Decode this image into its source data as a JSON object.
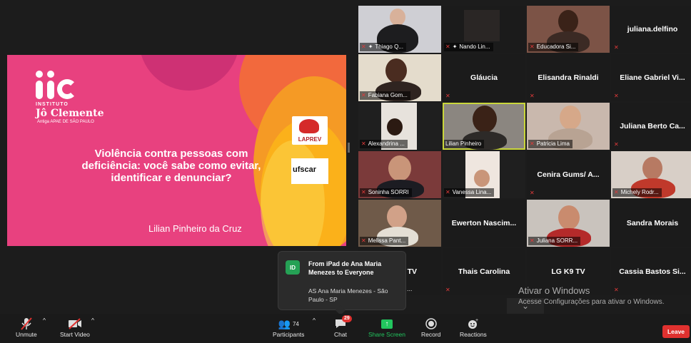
{
  "slide": {
    "logo_line1": "INSTITUTO",
    "logo_line2": "Jô Clemente",
    "logo_line3": "Antiga APAE DE SÃO PAULO",
    "title": "Violência contra pessoas com deficiência: você sabe como evitar, identificar e denunciar?",
    "author": "Lilian Pinheiro da Cruz",
    "partner1": "LAPREV",
    "partner2": "ufscar"
  },
  "tiles": [
    {
      "label": "Thiago Q...",
      "pinned": true
    },
    {
      "label": "Nando Lin...",
      "pinned": true
    },
    {
      "label": "Educadora Si..."
    },
    {
      "name": "juliana.delfino"
    },
    {
      "label": "Fabiana Gom..."
    },
    {
      "name": "Gláucia"
    },
    {
      "name": "Elisandra Rinaldi"
    },
    {
      "name": "Eliane Gabriel Vi..."
    },
    {
      "label": "Alexandrina ..."
    },
    {
      "label": "Lilian Pinheiro"
    },
    {
      "label": "Patricia Lima"
    },
    {
      "name": "Juliana Berto Ca..."
    },
    {
      "label": "Soninha SORRI"
    },
    {
      "label": "Vanessa Lina..."
    },
    {
      "name": "Cenira Gums/ A..."
    },
    {
      "label": "Michely Rodr..."
    },
    {
      "label": "Melissa Pant..."
    },
    {
      "name": "Ewerton Nascim..."
    },
    {
      "label": "Juliana SORR..."
    },
    {
      "name": "Sandra Morais"
    },
    {
      "name": "TV"
    },
    {
      "name": "Thais Carolina"
    },
    {
      "name": "LG K9 TV"
    },
    {
      "name": "Cassia Bastos Si..."
    }
  ],
  "chat_popup": {
    "avatar": "ID",
    "from": "From iPad de Ana Maria Menezes to Everyone",
    "message": "AS Ana Maria Menezes - São Paulo - SP",
    "truncated": "..."
  },
  "watermark": {
    "title": "Ativar o Windows",
    "subtitle": "Acesse Configurações para ativar o Windows."
  },
  "toolbar": {
    "unmute": "Unmute",
    "start_video": "Start Video",
    "participants": "Participants",
    "participants_count": "74",
    "chat": "Chat",
    "chat_badge": "29",
    "share_screen": "Share Screen",
    "record": "Record",
    "reactions": "Reactions",
    "leave": "Leave"
  },
  "colors": {
    "slide_pink": "#e8417f",
    "share_green": "#22c55e",
    "leave_red": "#e0312f",
    "active_speaker": "#c9d63a"
  }
}
